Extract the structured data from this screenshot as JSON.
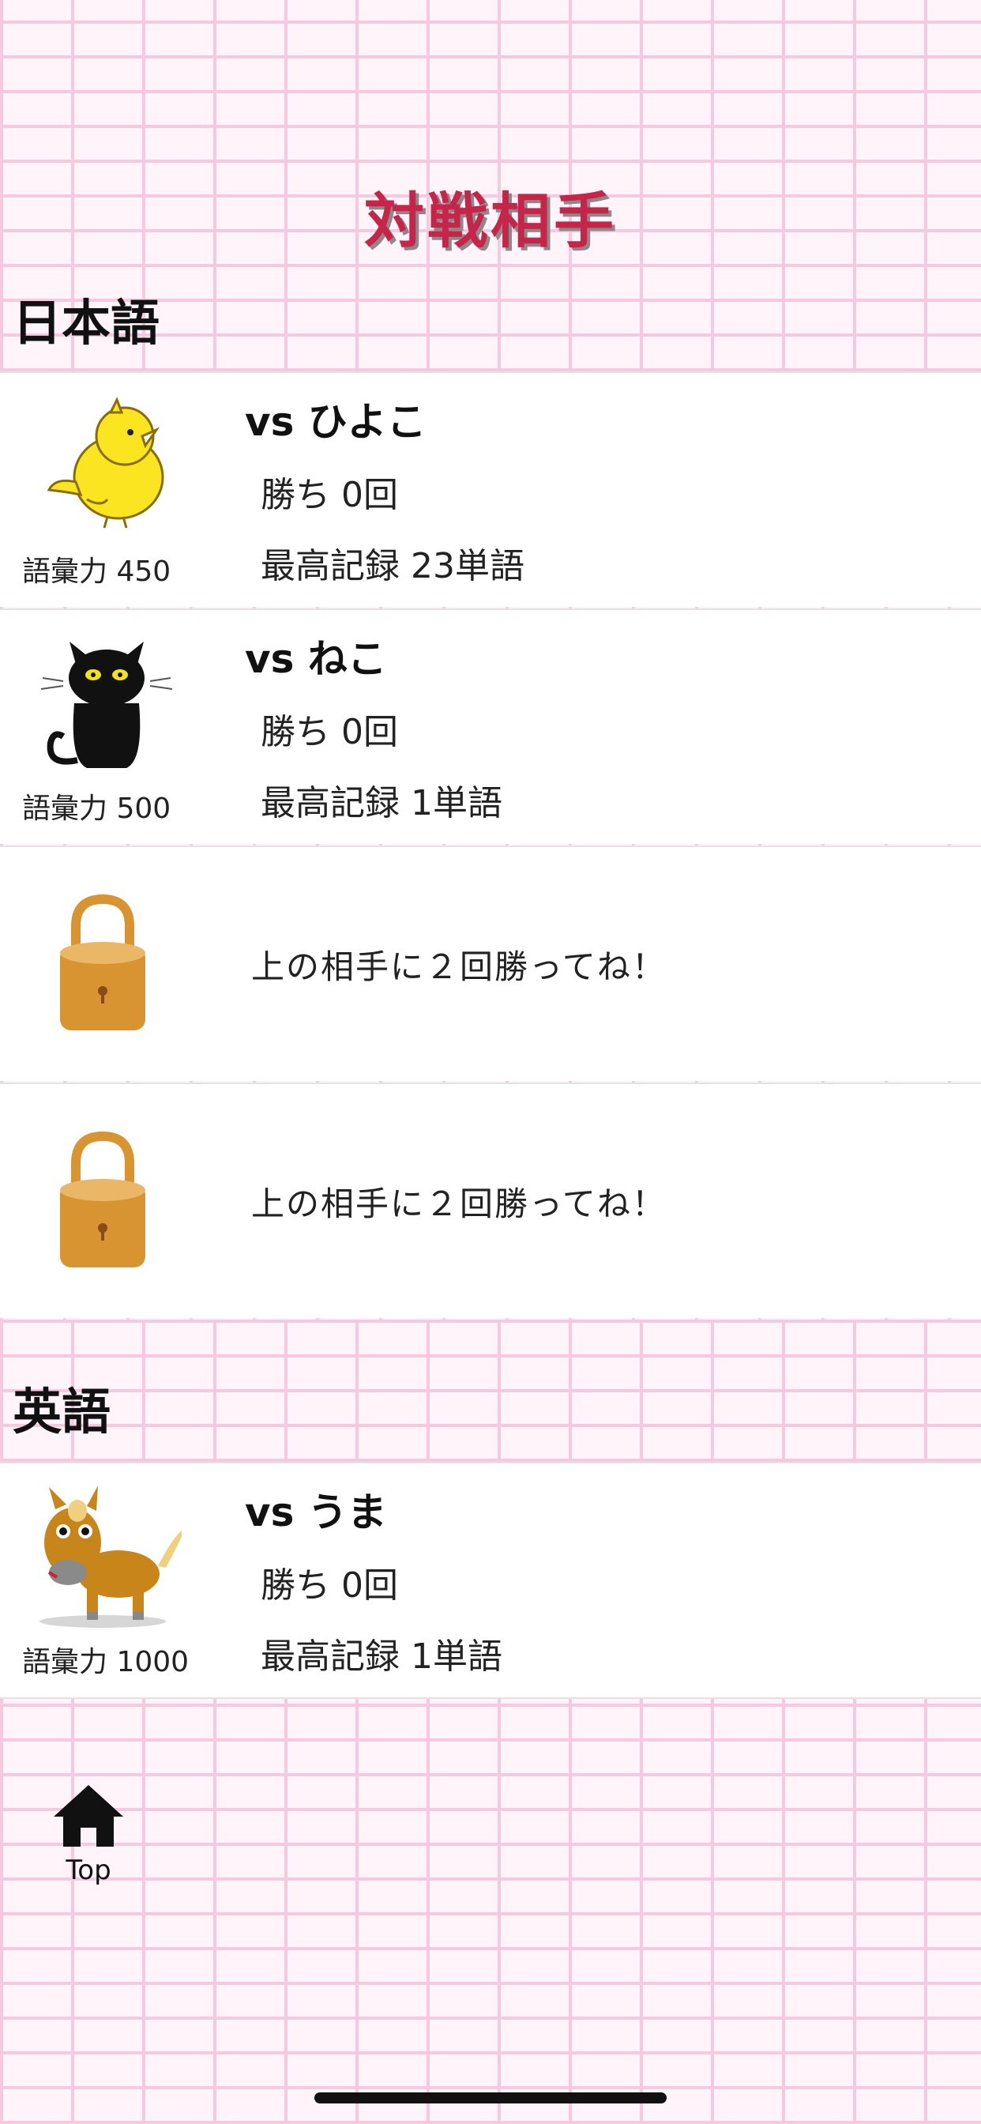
{
  "header": {
    "title": "対戦相手"
  },
  "sections": [
    {
      "label": "日本語",
      "opponents": [
        {
          "vs": "vs ひよこ",
          "wins": "勝ち 0回",
          "best": "最高記録 23単語",
          "vocab": "語彙力 450",
          "icon": "chick-icon"
        },
        {
          "vs": "vs ねこ",
          "wins": "勝ち 0回",
          "best": "最高記録 1単語",
          "vocab": "語彙力 500",
          "icon": "black-cat-icon"
        }
      ],
      "locked": [
        {
          "message": "上の相手に２回勝ってね！",
          "icon": "padlock-icon"
        },
        {
          "message": "上の相手に２回勝ってね！",
          "icon": "padlock-icon"
        }
      ]
    },
    {
      "label": "英語",
      "opponents": [
        {
          "vs": "vs うま",
          "wins": "勝ち 0回",
          "best": "最高記録 1単語",
          "vocab": "語彙力 1000",
          "icon": "horse-icon"
        }
      ]
    }
  ],
  "tabbar": {
    "top_label": "Top",
    "top_icon": "home-icon"
  },
  "colors": {
    "title": "#c8244a",
    "lock": "#d89430",
    "background": "#fff2f8"
  }
}
